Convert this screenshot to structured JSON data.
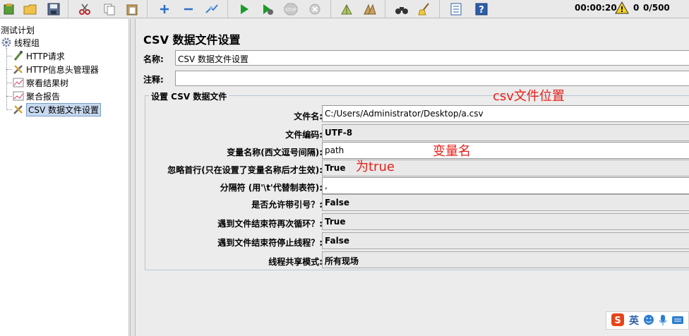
{
  "toolbar": {
    "elapsed_time": "00:00:20",
    "warning_count": "0",
    "thread_count": "0/500"
  },
  "tree": {
    "root": "测试计划",
    "thread_group": "线程组",
    "items": [
      {
        "label": "HTTP请求"
      },
      {
        "label": "HTTP信息头管理器"
      },
      {
        "label": "察看结果树"
      },
      {
        "label": "聚合报告"
      },
      {
        "label": "CSV 数据文件设置"
      }
    ]
  },
  "panel": {
    "title": "CSV 数据文件设置",
    "name_label": "名称:",
    "name_value": "CSV 数据文件设置",
    "comment_label": "注释:",
    "comment_value": "",
    "group_title": "设置 CSV 数据文件",
    "fields": {
      "filename": {
        "label": "文件名:",
        "value": "C:/Users/Administrator/Desktop/a.csv"
      },
      "encoding": {
        "label": "文件编码:",
        "value": "UTF-8"
      },
      "varnames": {
        "label": "变量名称(西文逗号间隔):",
        "value": "path"
      },
      "ignore_first": {
        "label": "忽略首行(只在设置了变量名称后才生效):",
        "value": "True"
      },
      "delimiter": {
        "label": "分隔符 (用'\\t'代替制表符):",
        "value": ","
      },
      "quoted": {
        "label": "是否允许带引号？:",
        "value": "False"
      },
      "recycle": {
        "label": "遇到文件结束符再次循环？:",
        "value": "True"
      },
      "stop_thread": {
        "label": "遇到文件结束符停止线程？:",
        "value": "False"
      },
      "sharing": {
        "label": "线程共享模式:",
        "value": "所有现场"
      }
    }
  },
  "annotations": {
    "csv_location": "csv文件位置",
    "var_name": "变量名",
    "set_true": "为true"
  },
  "ime": {
    "lang": "英"
  },
  "colors": {
    "annotation": "#e8201a",
    "selection": "#c7d9ef",
    "run_green": "#1a9c2a"
  }
}
